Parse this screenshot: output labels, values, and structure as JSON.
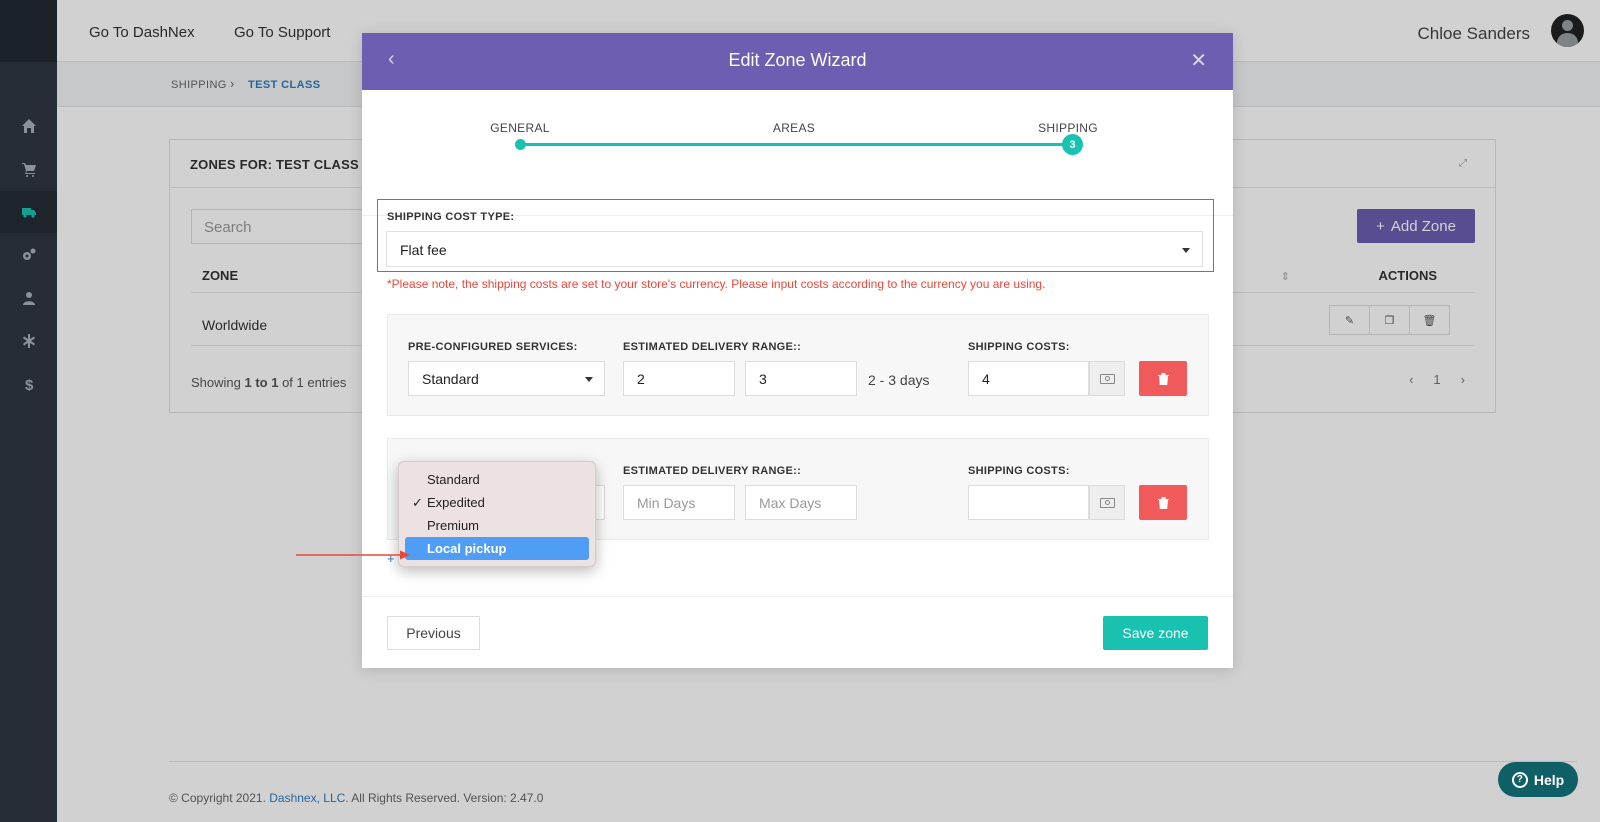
{
  "topbar": {
    "links": [
      "Go To DashNex",
      "Go To Support"
    ],
    "user_name": "Chloe Sanders"
  },
  "breadcrumb": {
    "parent": "SHIPPING",
    "current": "TEST CLASS"
  },
  "zones_panel": {
    "title": "ZONES FOR: TEST CLASS",
    "search_placeholder": "Search",
    "add_button": "Add Zone",
    "columns": {
      "zone": "ZONE",
      "actions": "ACTIONS"
    },
    "rows": [
      {
        "zone": "Worldwide"
      }
    ],
    "showing_prefix": "Showing ",
    "showing_range": "1 to 1",
    "showing_suffix": " of 1 entries",
    "page": "1"
  },
  "footer": {
    "prefix": "© Copyright 2021. ",
    "company": "Dashnex, LLC.",
    "suffix": " All Rights Reserved. Version: 2.47.0"
  },
  "help": {
    "label": "Help"
  },
  "modal": {
    "title": "Edit Zone Wizard",
    "steps": [
      {
        "label": "GENERAL"
      },
      {
        "label": "AREAS"
      },
      {
        "label": "SHIPPING",
        "number": "3"
      }
    ],
    "shipping_cost_type": {
      "label": "SHIPPING COST TYPE:",
      "value": "Flat fee"
    },
    "note": "*Please note, the shipping costs are set to your store's currency. Please input costs according to the currency you are using.",
    "services": [
      {
        "service_label": "PRE-CONFIGURED SERVICES:",
        "service_value": "Standard",
        "range_label": "ESTIMATED DELIVERY RANGE::",
        "min_days": "2",
        "max_days": "3",
        "range_text": "2 - 3 days",
        "cost_label": "SHIPPING COSTS:",
        "cost_value": "4"
      },
      {
        "range_label": "ESTIMATED DELIVERY RANGE::",
        "min_placeholder": "Min Days",
        "max_placeholder": "Max Days",
        "cost_label": "SHIPPING COSTS:",
        "cost_value": ""
      }
    ],
    "add_service": "+",
    "previous_button": "Previous",
    "save_button": "Save zone"
  },
  "service_dropdown": {
    "options": [
      "Standard",
      "Expedited",
      "Premium",
      "Local pickup"
    ],
    "checked": "Expedited",
    "highlighted": "Local pickup"
  },
  "colors": {
    "sidebar": "#2f3742",
    "accent_purple": "#6d5eb2",
    "accent_teal": "#19c2b0",
    "danger": "#f05a5a",
    "highlight_blue": "#4f9df5",
    "annotation_red": "#e8483b"
  }
}
